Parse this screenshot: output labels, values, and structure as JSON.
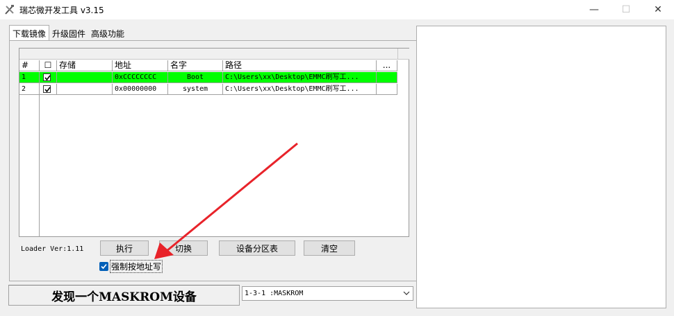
{
  "window": {
    "title": "瑞芯微开发工具 v3.15",
    "min_glyph": "—",
    "max_glyph": "☐",
    "close_glyph": "✕"
  },
  "tabs": [
    {
      "label": "下载镜像",
      "active": true
    },
    {
      "label": "升级固件",
      "active": false
    },
    {
      "label": "高级功能",
      "active": false
    }
  ],
  "grid": {
    "headers": [
      "#",
      "☐",
      "存储",
      "地址",
      "名字",
      "路径",
      "..."
    ],
    "rows": [
      {
        "num": "1",
        "checked": true,
        "storage": "",
        "address": "0xCCCCCCCC",
        "name": "Boot",
        "path": "C:\\Users\\xx\\Desktop\\EMMC刷写工...",
        "selected": true
      },
      {
        "num": "2",
        "checked": true,
        "storage": "",
        "address": "0x00000000",
        "name": "system",
        "path": "C:\\Users\\xx\\Desktop\\EMMC刷写工...",
        "selected": false
      }
    ]
  },
  "controls": {
    "loader_ver": "Loader Ver:1.11",
    "execute": "执行",
    "switch": "切换",
    "partition_table": "设备分区表",
    "clear": "清空",
    "force_write": "强制按地址写",
    "force_write_checked": true
  },
  "status": {
    "message": "发现一个MASKROM设备",
    "device": "1-3-1 :MASKROM"
  },
  "colors": {
    "selected_row": "#00ff00",
    "arrow": "#e8232a",
    "checkbox_accent": "#005fb8"
  }
}
